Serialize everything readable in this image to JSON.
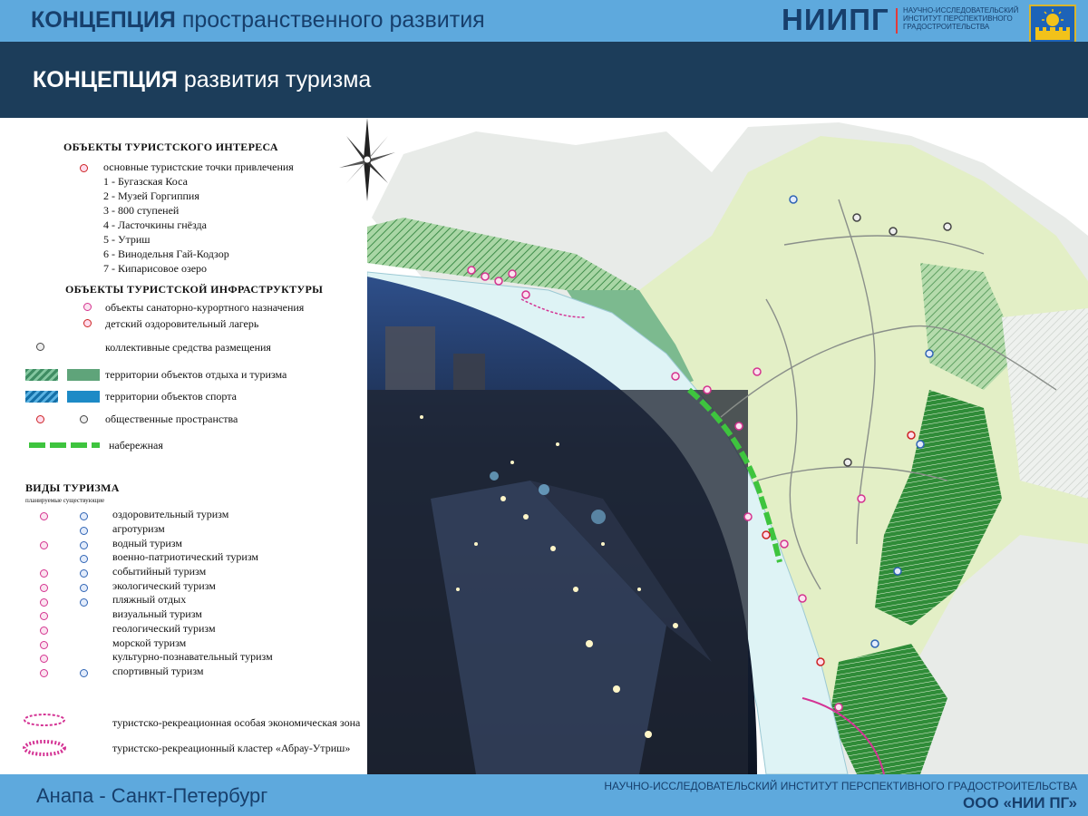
{
  "header": {
    "title_bold": "КОНЦЕПЦИЯ",
    "title_rest": " пространственного развития",
    "logo": "НИИПГ",
    "logo_subtitle": "НАУЧНО-ИССЛЕДОВАТЕЛЬСКИЙ ИНСТИТУТ ПЕРСПЕКТИВНОГО ГРАДОСТРОИТЕЛЬСТВА"
  },
  "section": {
    "title_bold": "КОНЦЕПЦИЯ",
    "title_rest": " развития туризма"
  },
  "legend": {
    "interest": {
      "heading": "ОБЪЕКТЫ ТУРИСТСКОГО ИНТЕРЕСА",
      "main_points": "основные туристские точки привлечения",
      "items": [
        "1 - Бугазская Коса",
        "2 - Музей Горгиппия",
        "3 - 800 ступеней",
        "4 - Ласточкины гнёзда",
        "5 - Утриш",
        "6 - Винодельня Гай-Кодзор",
        "7 - Кипарисовое озеро"
      ]
    },
    "infra": {
      "heading": "ОБЪЕКТЫ ТУРИСТСКОЙ ИНФРАСТРУКТУРЫ",
      "items": [
        "объекты санаторно-курортного назначения",
        "детский оздоровительный лагерь",
        "коллективные средства размещения",
        "территории объектов отдыха и туризма",
        "территории объектов спорта",
        "общественные пространства",
        "набережная"
      ]
    },
    "tourism": {
      "heading": "ВИДЫ ТУРИЗМА",
      "subheading": "планируемые существующие",
      "items": [
        "оздоровительный туризм",
        "агротуризм",
        "водный туризм",
        "военно-патриотический туризм",
        "событийный туризм",
        "экологический туризм",
        "пляжный отдых",
        "визуальный туризм",
        "геологический туризм",
        "морской туризм",
        "культурно-познавательный туризм",
        "спортивный туризм"
      ]
    },
    "zones": [
      "туристско-рекреационная особая экономическая зона",
      "туристско-рекреационный кластер «Абрау-Утриш»"
    ]
  },
  "colors": {
    "header_bg": "#5ea9dd",
    "section_bg": "#1c3d5a",
    "brand_text": "#173f6c",
    "recreation_green": "#5fa47a",
    "sport_blue": "#1d8ac6",
    "embankment_green": "#3ec43e",
    "zone_pink": "#d43394"
  },
  "footer": {
    "city": "Анапа - Санкт-Петербург",
    "institute": "НАУЧНО-ИССЛЕДОВАТЕЛЬСКИЙ ИНСТИТУТ ПЕРСПЕКТИВНОГО ГРАДОСТРОИТЕЛЬСТВА",
    "org": "ООО «НИИ ПГ»"
  }
}
